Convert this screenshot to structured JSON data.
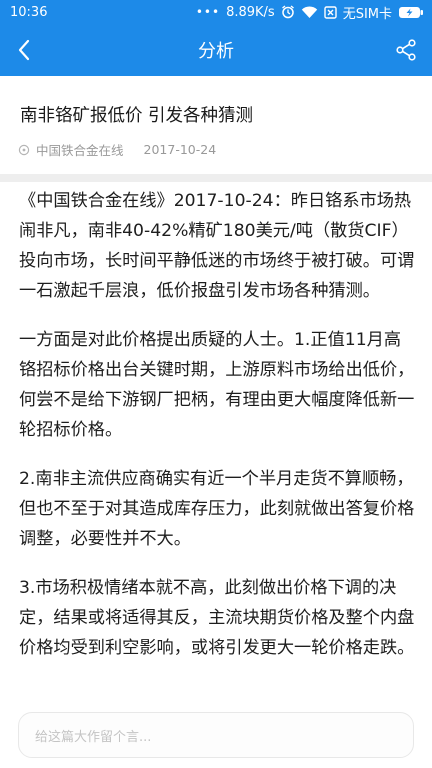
{
  "status": {
    "time": "10:36",
    "dots": "•••",
    "speed": "8.89K/s",
    "sim": "无SIM卡"
  },
  "appbar": {
    "title": "分析"
  },
  "article": {
    "title": "南非铬矿报低价 引发各种猜测",
    "source": "中国铁合金在线",
    "date": "2017-10-24",
    "paragraphs": [
      "《中国铁合金在线》2017-10-24：昨日铬系市场热闹非凡，南非40-42%精矿180美元/吨（散货CIF）投向市场，长时间平静低迷的市场终于被打破。可谓一石激起千层浪，低价报盘引发市场各种猜测。",
      "一方面是对此价格提出质疑的人士。1.正值11月高铬招标价格出台关键时期，上游原料市场给出低价，何尝不是给下游钢厂把柄，有理由更大幅度降低新一轮招标价格。",
      "2.南非主流供应商确实有近一个半月走货不算顺畅，但也不至于对其造成库存压力，此刻就做出答复价格调整，必要性并不大。",
      "3.市场积极情绪本就不高，此刻做出价格下调的决定，结果或将适得其反，主流块期货价格及整个内盘价格均受到利空影响，或将引发更大一轮价格走跌。"
    ]
  },
  "comment": {
    "placeholder": "给这篇大作留个言..."
  }
}
